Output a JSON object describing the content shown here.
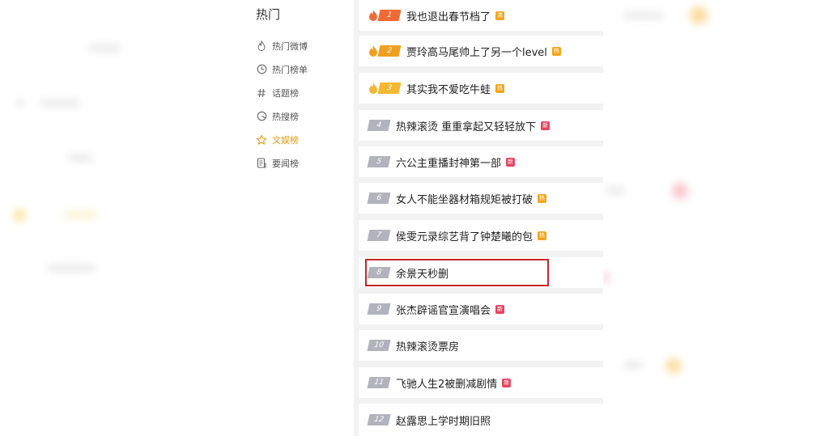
{
  "nav": {
    "title": "热门",
    "items": [
      {
        "label": "热门微博",
        "icon": "fire-outline-icon",
        "active": false
      },
      {
        "label": "热门榜单",
        "icon": "clock-icon",
        "active": false
      },
      {
        "label": "话题榜",
        "icon": "hashtag-icon",
        "active": false
      },
      {
        "label": "热搜榜",
        "icon": "search-circle-icon",
        "active": false
      },
      {
        "label": "文娱榜",
        "icon": "star-icon",
        "active": true
      },
      {
        "label": "要闻榜",
        "icon": "document-icon",
        "active": false
      }
    ]
  },
  "list": {
    "items": [
      {
        "rank": "1",
        "title": "我也退出春节档了",
        "badge": "沸",
        "badge_color": "orange"
      },
      {
        "rank": "2",
        "title": "贾玲高马尾帅上了另一个level",
        "badge": "热",
        "badge_color": "orange"
      },
      {
        "rank": "3",
        "title": "其实我不爱吃牛蛙",
        "badge": "热",
        "badge_color": "orange"
      },
      {
        "rank": "4",
        "title": "热辣滚烫 重重拿起又轻轻放下",
        "badge": "新",
        "badge_color": "red"
      },
      {
        "rank": "5",
        "title": "六公主重播封神第一部",
        "badge": "新",
        "badge_color": "red"
      },
      {
        "rank": "6",
        "title": "女人不能坐器材箱规矩被打破",
        "badge": "热",
        "badge_color": "orange"
      },
      {
        "rank": "7",
        "title": "侯雯元录综艺背了钟楚曦的包",
        "badge": "热",
        "badge_color": "orange"
      },
      {
        "rank": "8",
        "title": "余景天秒删",
        "badge": "",
        "badge_color": ""
      },
      {
        "rank": "9",
        "title": "张杰辟谣官宣演唱会",
        "badge": "新",
        "badge_color": "red"
      },
      {
        "rank": "10",
        "title": "热辣滚烫票房",
        "badge": "",
        "badge_color": ""
      },
      {
        "rank": "11",
        "title": "飞驰人生2被删减剧情",
        "badge": "新",
        "badge_color": "red"
      },
      {
        "rank": "12",
        "title": "赵露思上学时期旧照",
        "badge": "",
        "badge_color": ""
      }
    ]
  },
  "colors": {
    "accent_active": "#e99a19",
    "rank_first": "#f06a35",
    "rank_top": "#f0a020",
    "rank_default": "#b3b3be",
    "badge_hot": "#f4a51c",
    "badge_new": "#e6455f",
    "highlight": "#c4262e"
  }
}
